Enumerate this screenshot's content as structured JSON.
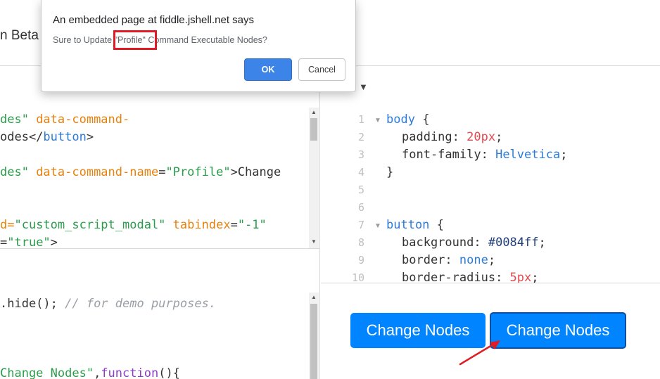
{
  "app": {
    "brand_fragment": "n Beta"
  },
  "dialog": {
    "title": "An embedded page at fiddle.jshell.net says",
    "message_before": "Sure to Update ",
    "message_highlight": "\"Profile\"",
    "message_after": " Command Executable Nodes?",
    "ok_label": "OK",
    "cancel_label": "Cancel"
  },
  "html_pane": {
    "l1a": "des\" ",
    "l1b": "data-command-",
    "l2a": "odes</",
    "l2b": "button",
    "l2c": ">",
    "l3a": "des\" ",
    "l3b": "data-command-name",
    "l3c": "=",
    "l3d": "\"Profile\"",
    "l3e": ">Change",
    "l4a": "d=",
    "l4b": "\"custom_script_modal\"",
    "l4c": " ",
    "l4d": "tabindex",
    "l4e": "=",
    "l4f": "\"-1\"",
    "l5a": "=",
    "l5b": "\"true\"",
    "l5c": ">"
  },
  "js_pane": {
    "l1a": ".hide(); ",
    "l1b": "// for demo purposes.",
    "l2a": "Change_Nodes\"",
    "l2b": ",",
    "l2c": "function",
    "l2d": "(){"
  },
  "css_pane": {
    "line_numbers": [
      "1",
      "2",
      "3",
      "4",
      "5",
      "6",
      "7",
      "8",
      "9",
      "10"
    ],
    "l1a": "body",
    "l1b": " {",
    "l2a": "padding",
    "l2b": ": ",
    "l2c": "20px",
    "l2d": ";",
    "l3a": "font-family",
    "l3b": ": ",
    "l3c": "Helvetica",
    "l3d": ";",
    "l4a": "}",
    "l7a": "button",
    "l7b": " {",
    "l8a": "background",
    "l8b": ": ",
    "l8c": "#0084ff",
    "l8d": ";",
    "l9a": "border",
    "l9b": ": ",
    "l9c": "none",
    "l9d": ";",
    "l10a": "border-radius",
    "l10b": ": ",
    "l10c": "5px",
    "l10d": ";"
  },
  "result": {
    "button1_label": "Change Nodes",
    "button2_label": "Change Nodes"
  },
  "icons": {
    "dropdown": "caret-down-icon",
    "fold": "fold-arrow-icon",
    "annotation": "red-arrow-icon"
  },
  "colors": {
    "button_blue": "#0084ff",
    "ok_blue": "#3c84e8",
    "highlight_red": "#e01b24"
  }
}
